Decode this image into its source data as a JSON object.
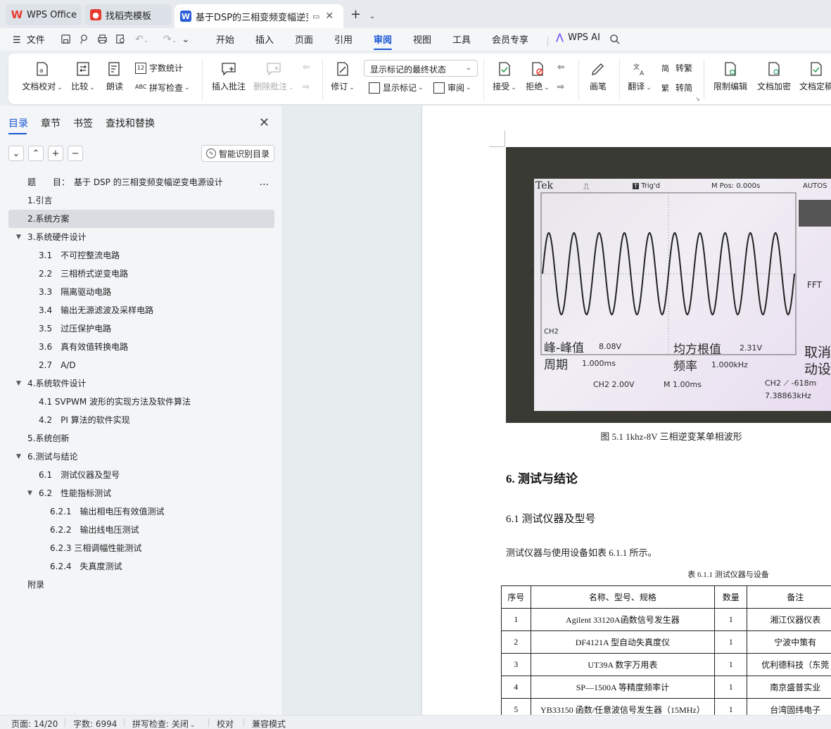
{
  "tabs": [
    {
      "label": "WPS Office",
      "icon": "wps-logo-icon"
    },
    {
      "label": "找稻壳模板",
      "icon": "docer-icon"
    },
    {
      "label": "基于DSP的三相变频变幅逆变电",
      "icon": "writer-icon"
    }
  ],
  "menu": {
    "file": "文件",
    "items": [
      "开始",
      "插入",
      "页面",
      "引用",
      "审阅",
      "视图",
      "工具",
      "会员专享"
    ],
    "active": "审阅",
    "ai": "WPS AI"
  },
  "ribbon": {
    "doc_check": "文档校对",
    "compare": "比较",
    "read_aloud": "朗读",
    "word_count": "字数统计",
    "spell_check": "拼写检查",
    "insert_comment": "插入批注",
    "delete_comment": "删除批注",
    "revise": "修订",
    "markup_select": "显示标记的最终状态",
    "show_markup": "显示标记",
    "review": "审阅",
    "accept": "接受",
    "reject": "拒绝",
    "pen": "画笔",
    "translate": "翻译",
    "to_traditional": "转繁",
    "to_simplified": "转简",
    "restrict_edit": "限制编辑",
    "doc_encrypt": "文档加密",
    "doc_finalize": "文档定稿"
  },
  "nav": {
    "tabs": [
      "目录",
      "章节",
      "书签",
      "查找和替换"
    ],
    "smart_toc": "智能识别目录",
    "toc": [
      {
        "label": "题　　目：　基于 DSP 的三相变频变幅逆变电源设计",
        "level": 1,
        "more": "..."
      },
      {
        "label": "1.引言",
        "level": 1
      },
      {
        "label": "2.系统方案",
        "level": 1,
        "selected": true
      },
      {
        "label": "3.系统硬件设计",
        "level": 1,
        "expanded": true
      },
      {
        "label": "3.1　不可控整流电路",
        "level": 2
      },
      {
        "label": "2.2　三相桥式逆变电路",
        "level": 2
      },
      {
        "label": "3.3　隔离驱动电路",
        "level": 2
      },
      {
        "label": "3.4　输出无源滤波及采样电路",
        "level": 2
      },
      {
        "label": "3.5　过压保护电路",
        "level": 2
      },
      {
        "label": "3.6　真有效值转换电路",
        "level": 2
      },
      {
        "label": "2.7　A/D",
        "level": 2
      },
      {
        "label": "4.系统软件设计",
        "level": 1,
        "expanded": true
      },
      {
        "label": "4.1 SVPWM 波形的实现方法及软件算法",
        "level": 2
      },
      {
        "label": "4.2　PI 算法的软件实现",
        "level": 2
      },
      {
        "label": "5.系统创新",
        "level": 1
      },
      {
        "label": "6.测试与结论",
        "level": 1,
        "expanded": true
      },
      {
        "label": "6.1　测试仪器及型号",
        "level": 2
      },
      {
        "label": "6.2　性能指标测试",
        "level": 2,
        "expanded": true
      },
      {
        "label": "6.2.1　输出相电压有效值测试",
        "level": 3
      },
      {
        "label": "6.2.2　输出线电压测试",
        "level": 3
      },
      {
        "label": "6.2.3 三相调幅性能测试",
        "level": 3
      },
      {
        "label": "6.2.4　失真度测试",
        "level": 3
      },
      {
        "label": "附录",
        "level": 1
      }
    ]
  },
  "doc": {
    "scope": {
      "brand": "Tek",
      "trig": "Trig'd",
      "mpos": "M Pos: 0.000s",
      "mode": "AUTOS",
      "ch_marker": "2",
      "ch_label": "CH2",
      "pk_label": "峰-峰值",
      "pk_value": "8.08V",
      "period_label": "周期",
      "period_value": "1.000ms",
      "rms_label": "均方根值",
      "rms_value": "2.31V",
      "freq_label": "频率",
      "freq_value": "1.000kHz",
      "side_fft": "FFT",
      "side_text1": "取消",
      "side_text2": "动设",
      "ch_scale": "CH2  2.00V",
      "time_scale": "M 1.00ms",
      "trig_level": "CH2 ⟋ -618m",
      "trig_freq": "7.38863kHz",
      "cycles": 10,
      "amplitude_v": 4.04
    },
    "figure_caption": "图 5.1 1khz-8V 三相逆变某单相波形",
    "heading1": "6.  测试与结论",
    "heading2": "6.1   测试仪器及型号",
    "paragraph": "测试仪器与使用设备如表 6.1.1 所示。",
    "table_caption": "表 6.1.1  测试仪器与设备",
    "table": {
      "headers": [
        "序号",
        "名称、型号、规格",
        "数量",
        "备注"
      ],
      "rows": [
        [
          "1",
          "Agilent 33120A函数信号发生器",
          "1",
          "湘江仪器仪表"
        ],
        [
          "2",
          "DF4121A 型自动失真度仪",
          "1",
          "宁波中策有"
        ],
        [
          "3",
          "UT39A 数字万用表",
          "1",
          "优利德科技（东莞"
        ],
        [
          "4",
          "SP—1500A 等精度频率计",
          "1",
          "南京盛普实业"
        ],
        [
          "5",
          "YB33150 函数/任意波信号发生器（15MHz）",
          "1",
          "台湾固纬电子"
        ]
      ]
    }
  },
  "status": {
    "page": "页面: 14/20",
    "words": "字数: 6994",
    "spell": "拼写检查: 关闭",
    "proof": "校对",
    "compat": "兼容模式"
  },
  "colors": {
    "accent": "#1a56d6",
    "wps_red": "#e8392c",
    "writer_blue": "#2b5fd9"
  }
}
